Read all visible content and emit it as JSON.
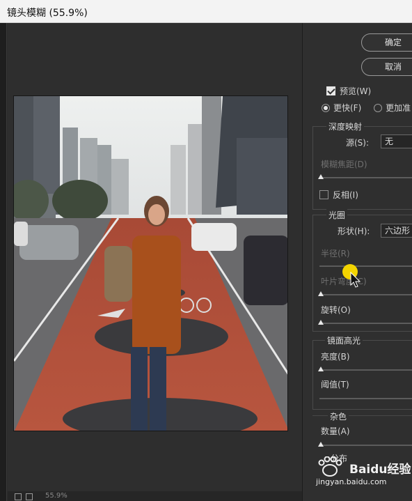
{
  "window": {
    "title": "镜头模糊 (55.9%)"
  },
  "buttons": {
    "ok": "确定",
    "cancel": "取消"
  },
  "options": {
    "preview": {
      "label": "预览(W)",
      "checked": true
    },
    "speed": [
      {
        "label": "更快(F)",
        "selected": true
      },
      {
        "label": "更加准",
        "selected": false
      }
    ]
  },
  "depth_map": {
    "heading": "深度映射",
    "source_label": "源(S):",
    "source_value": "无",
    "blur_focal_label": "模糊焦距(D)",
    "invert_label": "反相(I)",
    "invert_checked": false,
    "blur_focal_value": 0
  },
  "iris": {
    "heading": "光圈",
    "shape_label": "形状(H):",
    "shape_value": "六边形",
    "radius_label": "半径(R)",
    "radius_value": 0.3,
    "blade_label": "叶片弯度(C)",
    "blade_value": 0,
    "rotation_label": "旋转(O)",
    "rotation_value": 0
  },
  "specular": {
    "heading": "镜面高光",
    "brightness_label": "亮度(B)",
    "brightness_value": 0,
    "threshold_label": "阈值(T)",
    "threshold_value": 0
  },
  "noise": {
    "heading": "杂色",
    "amount_label": "数量(A)",
    "amount_value": 0,
    "distribution_label": "分布"
  },
  "statusbar": {
    "zoom_text": "55.9%"
  },
  "watermark": {
    "brand": "Baidu经验",
    "url": "jingyan.baidu.com"
  },
  "colors": {
    "accent_cursor": "#f3d400",
    "panel_bg": "#2f2f2f",
    "road": "#b6523a"
  }
}
